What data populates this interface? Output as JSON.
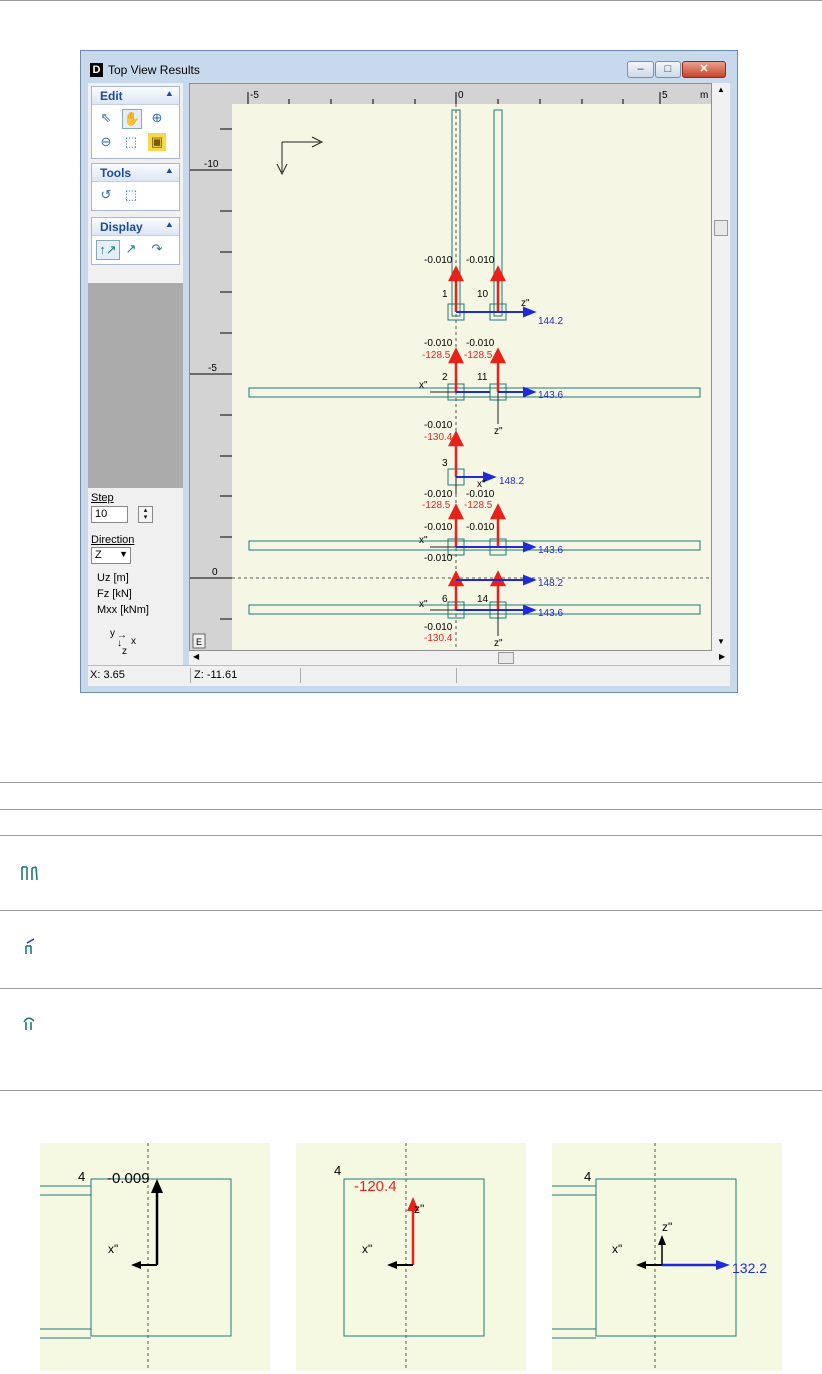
{
  "window": {
    "title": "Top View Results",
    "app_icon": "D",
    "buttons": {
      "minimize": "–",
      "maximize": "□",
      "close": "✕"
    }
  },
  "panel": {
    "edit_label": "Edit",
    "tools_label": "Tools",
    "display_label": "Display",
    "step_label": "Step",
    "step_value": "10",
    "direction_label": "Direction",
    "direction_value": "Z",
    "quantities": [
      "Uz [m]",
      "Fz [kN]",
      "Mxx [kNm]"
    ],
    "axes_y": "y",
    "axes_x": "x",
    "axes_z": "z"
  },
  "ruler": {
    "top_labels": [
      "-5",
      "0",
      "5",
      "m"
    ],
    "left_labels": [
      "-10",
      "-5",
      "0"
    ],
    "corner": "E"
  },
  "plot": {
    "node_numbers": [
      "1",
      "10",
      "2",
      "11",
      "3",
      "6",
      "14"
    ],
    "uz_values": [
      "-0.010",
      "-0.010",
      "-0.010",
      "-0.010",
      "-0.010",
      "-0.010",
      "-0.010",
      "-0.010",
      "-0.010",
      "-0.010",
      "-0.010"
    ],
    "fz_values": [
      "-128.5",
      "-128.5",
      "-130.4",
      "-128.5",
      "-128.5",
      "-130.4"
    ],
    "mxx_values": [
      "144.2",
      "143.6",
      "148.2",
      "143.6",
      "148.2",
      "143.6"
    ],
    "axis_x": "x\"",
    "axis_z": "z\""
  },
  "status": {
    "x": "X: 3.65",
    "z": "Z: -11.61"
  },
  "details": {
    "node": "4",
    "uz": "-0.009",
    "fz": "-120.4",
    "mxx": "132.2",
    "axis_x": "x\"",
    "axis_z": "z\""
  },
  "colors": {
    "fz": "#e8211b",
    "mxx": "#1f2bd6",
    "structure": "#1f7a78",
    "background": "#f5f6e4"
  }
}
